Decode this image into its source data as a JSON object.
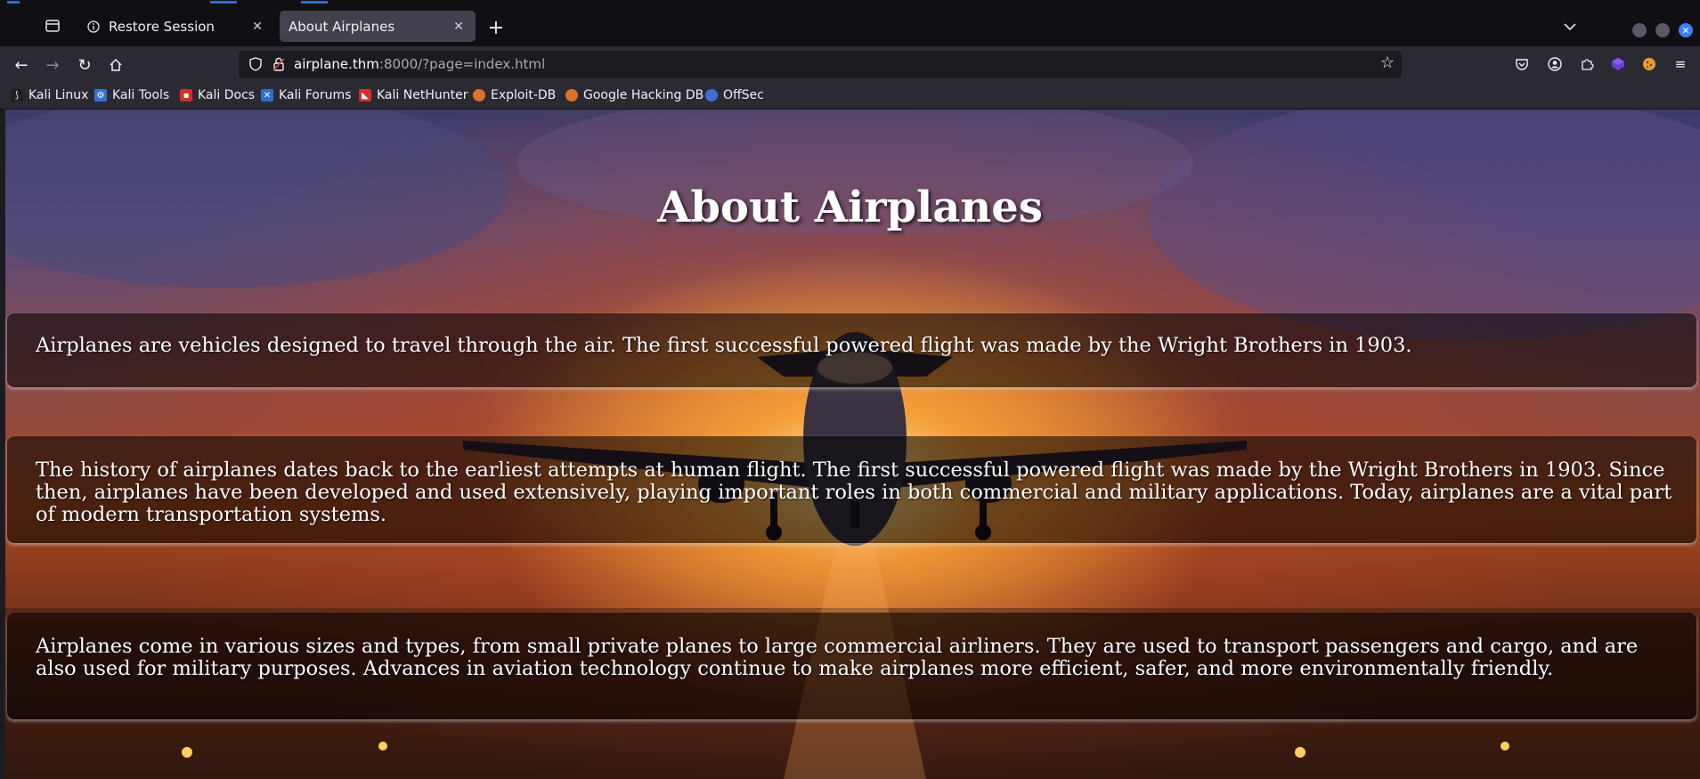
{
  "browser": {
    "tabs": [
      {
        "label": "Restore Session",
        "icon": "info-icon",
        "active": false
      },
      {
        "label": "About Airplanes",
        "icon": "",
        "active": true
      }
    ],
    "url_host": "airplane.thm",
    "url_rest": ":8000/?page=index.html",
    "bookmarks": [
      {
        "label": "Kali Linux",
        "icon": "kali-dragon-icon",
        "color": "#1f1f1f"
      },
      {
        "label": "Kali Tools",
        "icon": "kali-tools-icon",
        "color": "#3b6fd8"
      },
      {
        "label": "Kali Docs",
        "icon": "kali-docs-icon",
        "color": "#d0312d"
      },
      {
        "label": "Kali Forums",
        "icon": "kali-forums-icon",
        "color": "#2d6fd0"
      },
      {
        "label": "Kali NetHunter",
        "icon": "nethunter-icon",
        "color": "#d0312d"
      },
      {
        "label": "Exploit-DB",
        "icon": "exploit-db-icon",
        "color": "#e0702a"
      },
      {
        "label": "Google Hacking DB",
        "icon": "ghdb-icon",
        "color": "#e0702a"
      },
      {
        "label": "OffSec",
        "icon": "offsec-icon",
        "color": "#3b6fd8"
      }
    ],
    "window_controls_colors": [
      "#5a5a66",
      "#5a5a66",
      "#3b82f6"
    ]
  },
  "page": {
    "title": "About Airplanes",
    "paragraphs": [
      "Airplanes are vehicles designed to travel through the air. The first successful powered flight was made by the Wright Brothers in 1903.",
      "The history of airplanes dates back to the earliest attempts at human flight. The first successful powered flight was made by the Wright Brothers in 1903. Since then, airplanes have been developed and used extensively, playing important roles in both commercial and military applications. Today, airplanes are a vital part of modern transportation systems.",
      "Airplanes come in various sizes and types, from small private planes to large commercial airliners. They are used to transport passengers and cargo, and are also used for military purposes. Advances in aviation technology continue to make airplanes more efficient, safer, and more environmentally friendly."
    ]
  }
}
